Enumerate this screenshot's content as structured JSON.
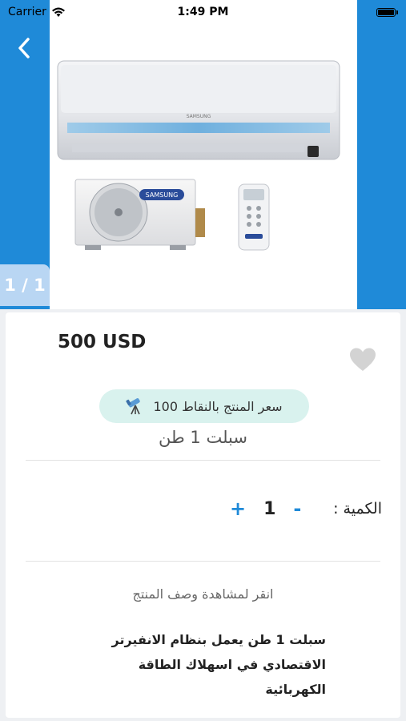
{
  "status_bar": {
    "carrier": "Carrier",
    "time": "1:49 PM"
  },
  "gallery": {
    "pager": "1 / 1",
    "brand": "SAMSUNG"
  },
  "product": {
    "price": "500 USD",
    "points_badge": "سعر المنتج بالنقاط 100",
    "name": "سبلت 1 طن",
    "quantity_label": "الكمية :",
    "quantity_value": "1",
    "minus": "-",
    "plus": "+",
    "description_hint": "انقر لمشاهدة وصف المنتج",
    "description": "سبلت 1 طن يعمل بنظام الانفيرتر الاقتصادي في اسهلاك الطاقة الكهربائية"
  },
  "colors": {
    "accent_blue": "#1f8ad8",
    "badge_bg": "#d9f2ee",
    "pager_bg": "#b9d6f3",
    "heart": "#d3d3d3"
  },
  "icons": {
    "back": "chevron-left-icon",
    "heart": "heart-icon",
    "points": "telescope-icon",
    "wifi": "wifi-icon",
    "battery": "battery-icon"
  }
}
